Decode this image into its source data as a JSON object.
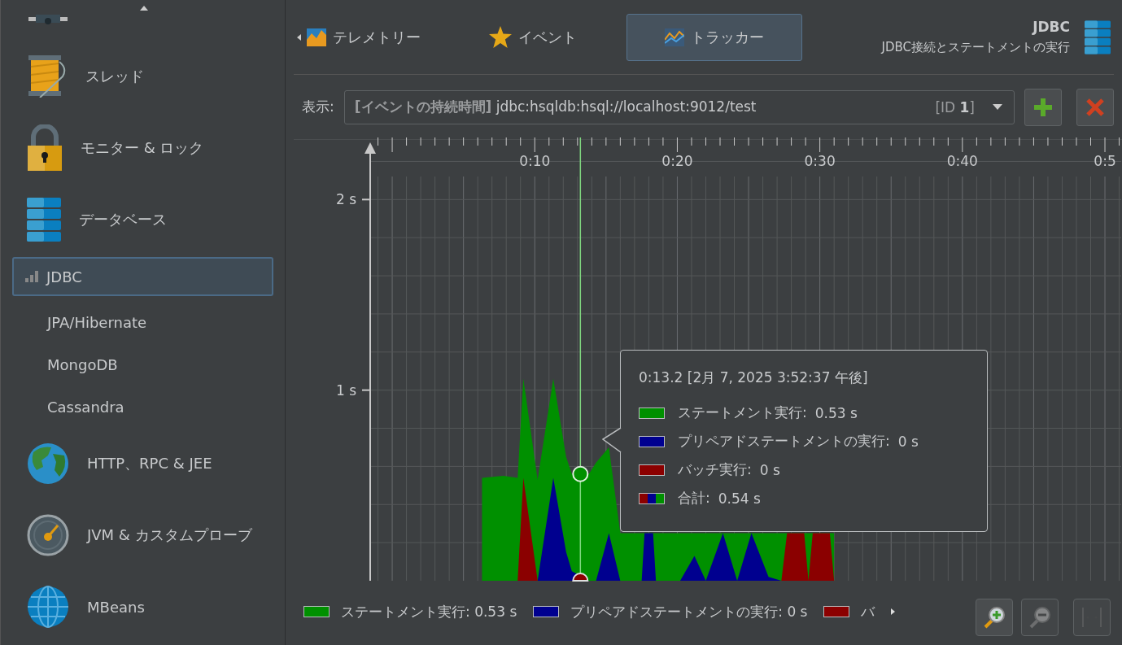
{
  "sidebar": {
    "items": [
      {
        "kind": "category",
        "label": "スレッド",
        "selected": false
      },
      {
        "kind": "category",
        "label": "モニター & ロック",
        "selected": false
      },
      {
        "kind": "category",
        "label": "データベース",
        "selected": false
      },
      {
        "kind": "sub",
        "label": "JDBC",
        "selected": true
      },
      {
        "kind": "sub",
        "label": "JPA/Hibernate",
        "selected": false
      },
      {
        "kind": "sub",
        "label": "MongoDB",
        "selected": false
      },
      {
        "kind": "sub",
        "label": "Cassandra",
        "selected": false
      },
      {
        "kind": "category",
        "label": "HTTP、RPC & JEE",
        "selected": false
      },
      {
        "kind": "category",
        "label": "JVM & カスタムプローブ",
        "selected": false
      },
      {
        "kind": "category",
        "label": "MBeans",
        "selected": false
      }
    ]
  },
  "tabs": [
    {
      "label": "テレメトリー",
      "selected": false
    },
    {
      "label": "イベント",
      "selected": false
    },
    {
      "label": "トラッカー",
      "selected": true
    }
  ],
  "header": {
    "title": "JDBC",
    "subtitle": "JDBC接続とステートメントの実行"
  },
  "filter": {
    "label": "表示:",
    "value": "**[イベントの持続時間]** jdbc:hsqldb:hsql://localhost:9012/test",
    "id": "[ID **1**]"
  },
  "chart": {
    "chart_data": {
      "type": "area",
      "stacked": false,
      "grid": true,
      "xlim": [
        -6.91,
        51.14
      ],
      "ylim": [
        0,
        2.266
      ],
      "xticks": [
        {
          "value": 10,
          "label": "0:10"
        },
        {
          "value": 20,
          "label": "0:20"
        },
        {
          "value": 30,
          "label": "0:30"
        },
        {
          "value": 40,
          "label": "0:40"
        },
        {
          "value": 50,
          "label": "0:5"
        }
      ],
      "yticks": [
        {
          "value": 1,
          "label": "1 s"
        },
        {
          "value": 2,
          "label": "2 s"
        }
      ],
      "ref_lines": [
        {
          "axis": "x",
          "value": 13.2
        }
      ],
      "x": [
        6.3,
        7.8,
        8.8,
        9.2,
        10.2,
        11.3,
        12.2,
        12.6,
        13.8,
        14.3,
        15.2,
        16.0,
        17.5,
        17.7,
        18.3,
        18.5,
        20.2,
        21.2,
        22.0,
        23.2,
        24.2,
        25.2,
        26.4,
        27.3,
        27.7,
        28.9,
        29.2,
        29.5,
        30.7,
        31.0
      ],
      "series": [
        {
          "name": "ステートメント実行",
          "color": "#009000",
          "values": [
            0.54,
            0.55,
            0.54,
            1.06,
            0.53,
            1.06,
            0.65,
            0.56,
            0.56,
            0.62,
            0.7,
            0.25,
            0.25,
            0.25,
            0.25,
            0.25,
            0.25,
            0.25,
            0.25,
            0.25,
            0.25,
            0.25,
            0.25,
            0.25,
            0.25,
            0.25,
            0.25,
            0.25,
            0.25,
            0.25
          ]
        },
        {
          "name": "プリペアドステートメントの実行",
          "color": "#00008f",
          "values": [
            null,
            null,
            null,
            null,
            0,
            0.54,
            0.15,
            0.05,
            0,
            0,
            0.25,
            0,
            0,
            0.25,
            0.25,
            0,
            0,
            0.13,
            0,
            0.25,
            0,
            0.25,
            0.02,
            0,
            null,
            null,
            null,
            null,
            null,
            null
          ]
        },
        {
          "name": "バッチ実行",
          "color": "#8b0000",
          "values": [
            null,
            null,
            0,
            0.54,
            0,
            null,
            null,
            null,
            null,
            null,
            null,
            null,
            null,
            null,
            null,
            null,
            null,
            null,
            null,
            null,
            null,
            null,
            null,
            0,
            0.25,
            0.25,
            0,
            0.25,
            0.25,
            0
          ]
        }
      ]
    },
    "tooltip": {
      "title": "0:13.2 [2月 7, 2025 3:52:37 午後]",
      "rows": [
        {
          "kind": "series",
          "suffix": ":",
          "value": "0.53 s"
        },
        {
          "kind": "series",
          "suffix": ":",
          "value": "0 s"
        },
        {
          "kind": "series",
          "suffix": ":",
          "value": "0 s"
        },
        {
          "kind": "total",
          "label": "合計:",
          "value": "0.54 s"
        }
      ]
    }
  },
  "legend": [
    {
      "text": "ステートメント実行: 0.53 s",
      "color": "#009000"
    },
    {
      "text": "プリペアドステートメントの実行: 0 s",
      "color": "#00008f"
    },
    {
      "text": "バ",
      "color": "#8b0000"
    }
  ],
  "tools": [
    {
      "kind": "zoom-in",
      "disabled": false
    },
    {
      "kind": "zoom-out",
      "disabled": true
    },
    {
      "kind": "fit",
      "disabled": true
    }
  ]
}
